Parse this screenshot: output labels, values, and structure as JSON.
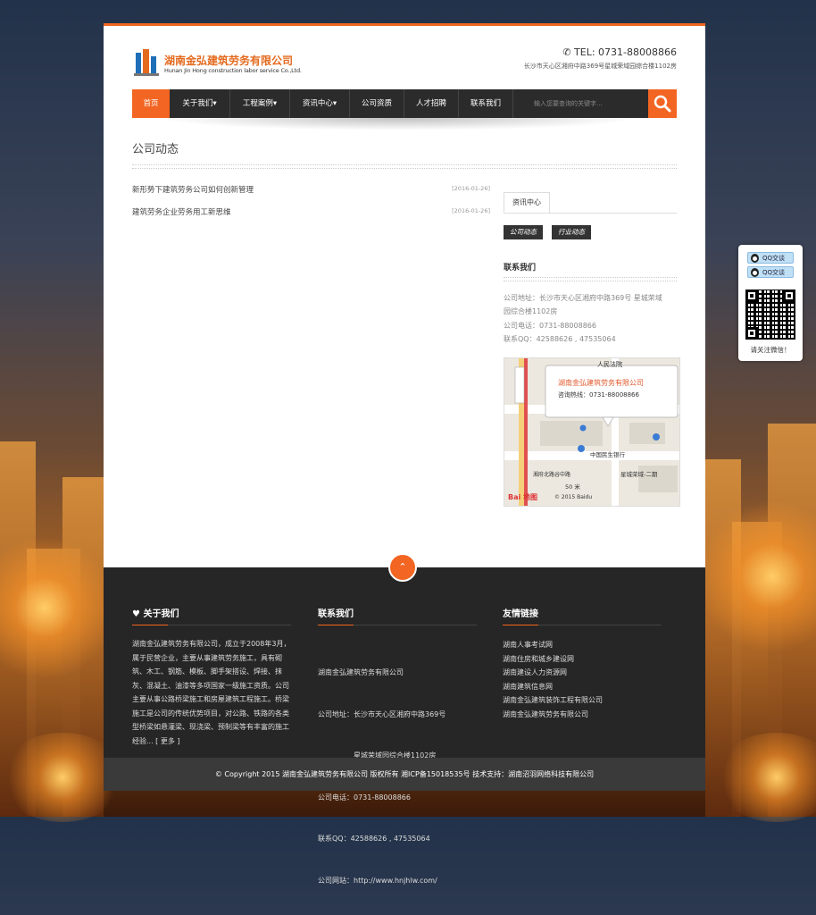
{
  "header": {
    "logo_cn": "湖南金弘建筑劳务有限公司",
    "logo_en": "Hunan Jin Hong construction labor service Co.,Ltd.",
    "phone": "TEL: 0731-88008866",
    "address": "长沙市天心区湘府中路369号星城荣域园综合楼1102房"
  },
  "nav": {
    "items": [
      "首页",
      "关于我们▾",
      "工程案例▾",
      "资讯中心▾",
      "公司资质",
      "人才招聘",
      "联系我们"
    ],
    "search_placeholder": "输入您要查询的关键字..."
  },
  "main": {
    "title": "公司动态",
    "news": [
      {
        "title": "新形势下建筑劳务公司如何创新管理",
        "date": "[2016-01-26]"
      },
      {
        "title": "建筑劳务企业劳务用工新思维",
        "date": "[2016-01-26]"
      }
    ]
  },
  "sidebar": {
    "tab": "资讯中心",
    "categories": [
      "公司动态",
      "行业动态"
    ],
    "contact_heading": "联系我们",
    "address_line1": "公司地址：长沙市天心区湘府中路369号 星城荣域",
    "address_line2": "园综合楼1102房",
    "phone": "公司电话：0731-88008866",
    "qq": "联系QQ：42588626 , 47535064",
    "map": {
      "popup_title": "湖南金弘建筑劳务有限公司",
      "popup_phone": "咨询热线：0731-88008866",
      "label_top": "人民法院",
      "label_bank": "中国民生银行",
      "label_road": "星城荣域-二期",
      "label_scale": "50 米",
      "label_brand": "Bai 地图",
      "label_copy": "© 2015 Baidu",
      "label_area": "湘府北路谷中路"
    }
  },
  "footer": {
    "about_heading": "♥ 关于我们",
    "about_lines": [
      "湖南金弘建筑劳务有限公司，成立于2008年3月，",
      "属于民营企业，主要从事建筑劳务施工，具有砌",
      "筑、木工、钢筋、模板、脚手架搭设、焊接、抹",
      "灰、混凝土、油漆等多项国家一级施工资质。公司",
      "主要从事公路桥梁施工和房屋建筑工程施工。桥梁",
      "施工是公司的传统优势项目，对公路、铁路的各类",
      "型桥梁如悬灌梁、现浇梁、预制梁等有丰富的施工",
      "经验...  [  更多  ]"
    ],
    "contact_heading": "联系我们",
    "contact_lines": [
      "湖南金弘建筑劳务有限公司",
      "公司地址：长沙市天心区湘府中路369号",
      "　　　　　星城荣域园综合楼1102房",
      "公司电话：0731-88008866",
      "联系QQ：42588626 , 47535064",
      "公司网站：http://www.hnjhlw.com/"
    ],
    "links_heading": "友情链接",
    "links": [
      "湖南人事考试网",
      "湖南住房和城乡建设网",
      "湖南建设人力资源网",
      "湖南建筑信息网",
      "湖南金弘建筑装饰工程有限公司",
      "湖南金弘建筑劳务有限公司"
    ],
    "copyright": "© Copyright 2015  湖南金弘建筑劳务有限公司 版权所有  湘ICP备15018535号     技术支持：湖南沼羽网络科技有限公司"
  },
  "qq_widget": {
    "btn1": "QQ交谈",
    "btn2": "QQ交谈",
    "caption": "请关注微信！"
  },
  "colors": {
    "accent": "#f26522",
    "nav": "#2b2b2b",
    "footer": "#262626"
  }
}
